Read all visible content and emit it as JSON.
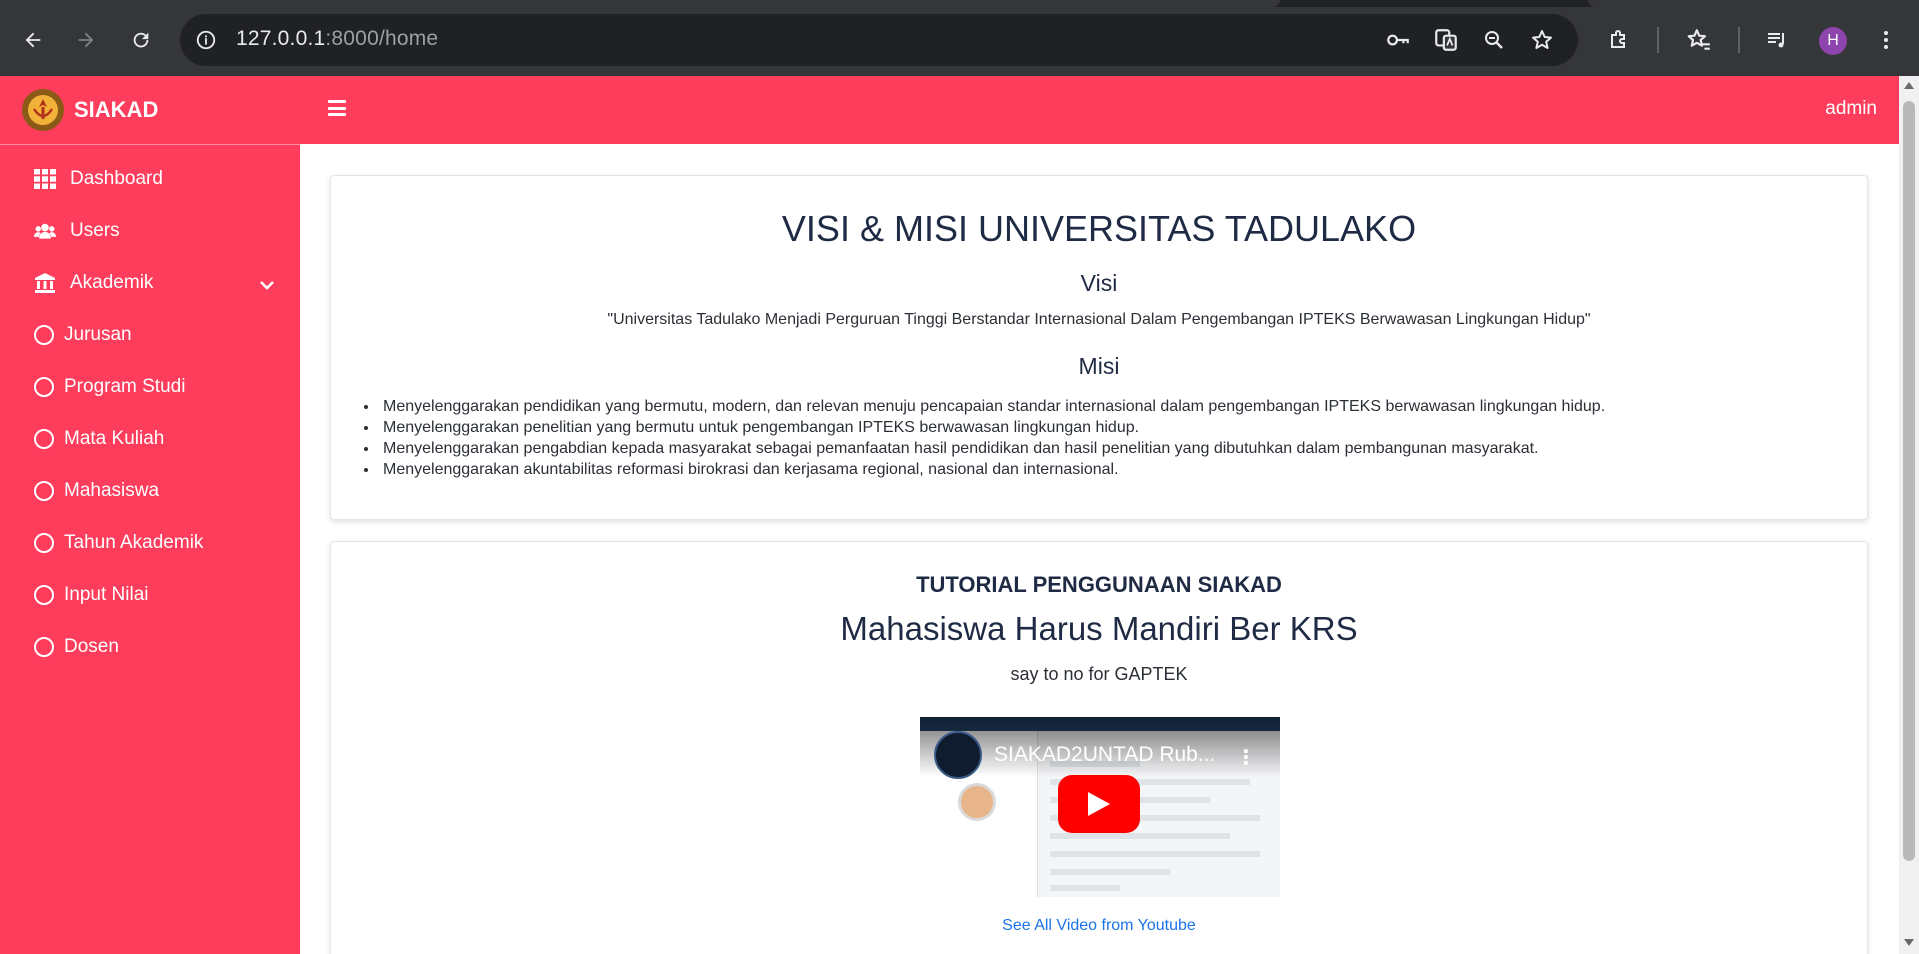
{
  "browser": {
    "url_host": "127.0.0.1",
    "url_rest": ":8000/home",
    "profile_initial": "H"
  },
  "sidebar": {
    "brand": "SIAKAD",
    "items": [
      {
        "label": "Dashboard",
        "icon": "grid-icon"
      },
      {
        "label": "Users",
        "icon": "users-icon"
      },
      {
        "label": "Akademik",
        "icon": "institution-icon"
      },
      {
        "label": "Jurusan",
        "icon": "circle-icon"
      },
      {
        "label": "Program Studi",
        "icon": "circle-icon"
      },
      {
        "label": "Mata Kuliah",
        "icon": "circle-icon"
      },
      {
        "label": "Mahasiswa",
        "icon": "circle-icon"
      },
      {
        "label": "Tahun Akademik",
        "icon": "circle-icon"
      },
      {
        "label": "Input Nilai",
        "icon": "circle-icon"
      },
      {
        "label": "Dosen",
        "icon": "circle-icon"
      }
    ]
  },
  "topbar": {
    "user": "admin"
  },
  "visimisi": {
    "title": "VISI & MISI UNIVERSITAS TADULAKO",
    "visi_heading": "Visi",
    "visi_text": "\"Universitas Tadulako Menjadi Perguruan Tinggi Berstandar Internasional Dalam Pengembangan IPTEKS Berwawasan Lingkungan Hidup\"",
    "misi_heading": "Misi",
    "misi_items": [
      "Menyelenggarakan pendidikan yang bermutu, modern, dan relevan menuju pencapaian standar internasional dalam pengembangan IPTEKS berwawasan lingkungan hidup.",
      "Menyelenggarakan penelitian yang bermutu untuk pengembangan IPTEKS berwawasan lingkungan hidup.",
      "Menyelenggarakan pengabdian kepada masyarakat sebagai pemanfaatan hasil pendidikan dan hasil penelitian yang dibutuhkan dalam pembangunan masyarakat.",
      "Menyelenggarakan akuntabilitas reformasi birokrasi dan kerjasama regional, nasional dan internasional."
    ]
  },
  "tutorial": {
    "heading": "TUTORIAL PENGGUNAAN SIAKAD",
    "subheading": "Mahasiswa Harus Mandiri Ber KRS",
    "tagline": "say to no for GAPTEK",
    "video_title": "SIAKAD2UNTAD Rub...",
    "link_text": "See All Video from Youtube"
  }
}
